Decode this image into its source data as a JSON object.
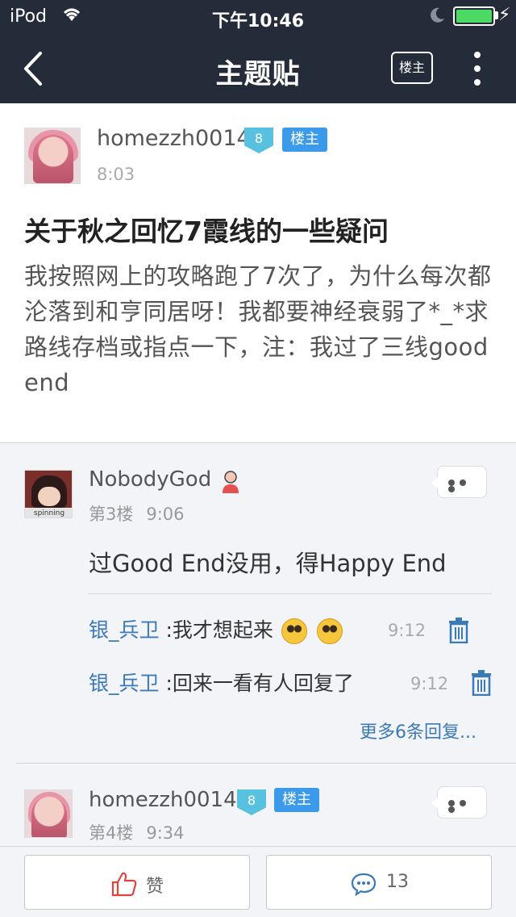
{
  "status_bar": {
    "carrier": "iPod",
    "time": "下午10:46"
  },
  "nav": {
    "title": "主题贴",
    "owner_filter": "楼主"
  },
  "post": {
    "author": "homezzh0014",
    "level": "8",
    "op_badge": "楼主",
    "time": "8:03",
    "title": "关于秋之回忆7霞线的一些疑问",
    "body": "我按照网上的攻略跑了7次了，为什么每次都沦落到和亨同居呀！我都要神经衰弱了*_*求路线存档或指点一下，注：我过了三线good end"
  },
  "replies": [
    {
      "author": "NobodyGod",
      "avatar_caption": "spinning",
      "floor": "第3楼",
      "time": "9:06",
      "content": "过Good End没用，得Happy End",
      "sub_replies": [
        {
          "name": "银_兵卫",
          "text": ":我才想起来",
          "time": "9:12"
        },
        {
          "name": "银_兵卫",
          "text": ":回来一看有人回复了",
          "time": "9:12"
        }
      ],
      "more_replies": "更多6条回复..."
    },
    {
      "author": "homezzh0014",
      "level": "8",
      "op_badge": "楼主",
      "floor": "第4楼",
      "time": "9:34"
    }
  ],
  "bottom_bar": {
    "like_label": "赞",
    "comment_count": "13"
  },
  "colors": {
    "header_bg": "#252c39",
    "link_blue": "#3b79b7",
    "op_badge": "#3b9bea",
    "level_badge": "#59c1e0"
  }
}
